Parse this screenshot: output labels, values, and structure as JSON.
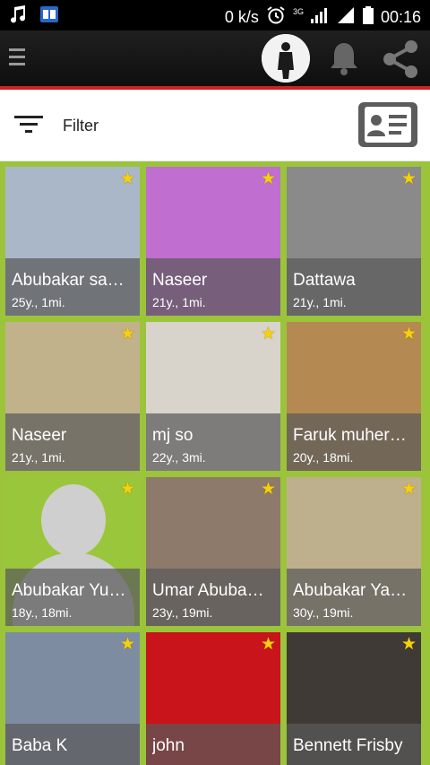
{
  "status_bar": {
    "speed": "0 k/s",
    "network": "3G",
    "time": "00:16"
  },
  "app_bar": {
    "menu_icon": "hamburger-icon",
    "avatar_icon": "profile-avatar",
    "bell_icon": "bell-icon",
    "share_icon": "share-icon"
  },
  "filter": {
    "label": "Filter",
    "icon": "filter-lines-icon",
    "contact_icon": "contact-card-icon"
  },
  "profiles": [
    {
      "name": "Abubakar sa…",
      "meta": "25y., 1mi.",
      "bg": "#aab7c8"
    },
    {
      "name": "Naseer",
      "meta": "21y., 1mi.",
      "bg": "#c06ecf"
    },
    {
      "name": "Dattawa",
      "meta": "21y., 1mi.",
      "bg": "#8a8a8a"
    },
    {
      "name": "Naseer",
      "meta": "21y., 1mi.",
      "bg": "#c2b28c"
    },
    {
      "name": "mj so",
      "meta": "22y., 3mi.",
      "bg": "#d8d4cc"
    },
    {
      "name": "Faruk muher…",
      "meta": "20y., 18mi.",
      "bg": "#b48a52"
    },
    {
      "name": "Abubakar Yu…",
      "meta": "18y., 18mi.",
      "bg": "#9ac63c"
    },
    {
      "name": "Umar Abuba…",
      "meta": "23y., 19mi.",
      "bg": "#8e7a6a"
    },
    {
      "name": "Abubakar Ya…",
      "meta": "30y., 19mi.",
      "bg": "#bfb08d"
    },
    {
      "name": "Baba K",
      "meta": "",
      "bg": "#7d8ca1"
    },
    {
      "name": "john",
      "meta": "",
      "bg": "#c8141a"
    },
    {
      "name": "Bennett Frisby",
      "meta": "",
      "bg": "#3f3a35"
    }
  ],
  "colors": {
    "accent_red": "#d21f22",
    "grid_background": "#9bc43a",
    "star": "#f6d10b"
  }
}
